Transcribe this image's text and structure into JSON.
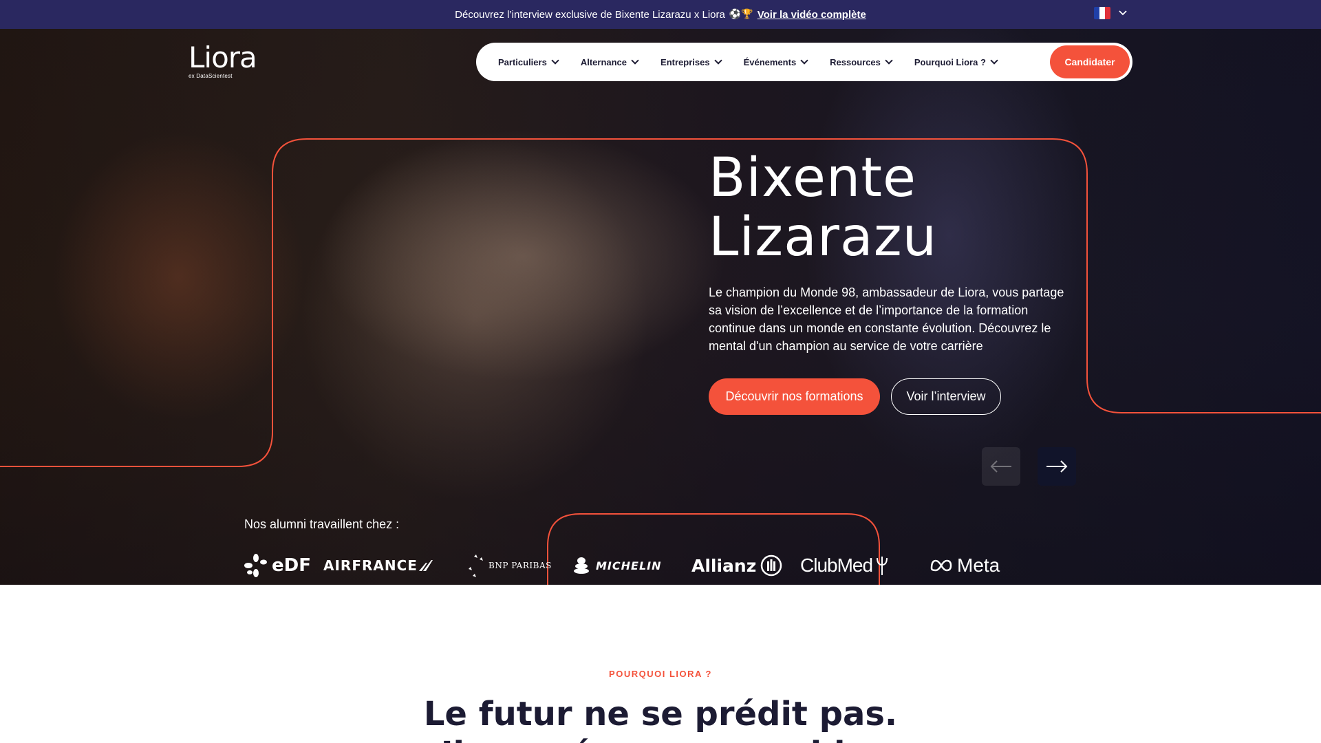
{
  "topbar": {
    "message": "Découvrez l’interview exclusive de Bixente Lizarazu x Liora",
    "emoji": "⚽🏆",
    "link": "Voir la vidéo complète",
    "flag_colors": [
      "#1f3fa8",
      "#ffffff",
      "#e0303a"
    ]
  },
  "logo": {
    "word": "Liora",
    "sub": "ex DataScientest"
  },
  "nav": {
    "items": [
      {
        "label": "Particuliers"
      },
      {
        "label": "Alternance"
      },
      {
        "label": "Entreprises"
      },
      {
        "label": "Événements"
      },
      {
        "label": "Ressources"
      },
      {
        "label": "Pourquoi Liora ?"
      }
    ],
    "cta": "Candidater"
  },
  "hero": {
    "title_line1": "Bixente",
    "title_line2": "Lizarazu",
    "description": "Le champion du Monde 98, ambassadeur de Liora, vous partage sa vision de l’excellence et de l’importance de la formation continue dans un monde en constante évolution. Découvrez le mental d'un champion au service de votre carrière",
    "primary_button": "Découvrir nos formations",
    "secondary_button": "Voir l’interview",
    "accent_color": "#f4523b"
  },
  "alumni": {
    "label": "Nos alumni travaillent chez :",
    "brands": {
      "edf": "eDF",
      "airfrance": "AIRFRANCE",
      "bnp": "BNP PARIBAS",
      "michelin": "MICHELIN",
      "allianz": "Allianz",
      "clubmed": "ClubMed",
      "meta": "Meta"
    }
  },
  "section": {
    "eyebrow": "POURQUOI LIORA ?",
    "title": "Le futur ne se prédit pas.",
    "title_partial": "Il se prépare ensemble."
  },
  "colors": {
    "navy": "#2a2860",
    "accent": "#f4523b",
    "text": "#1c1b33"
  }
}
